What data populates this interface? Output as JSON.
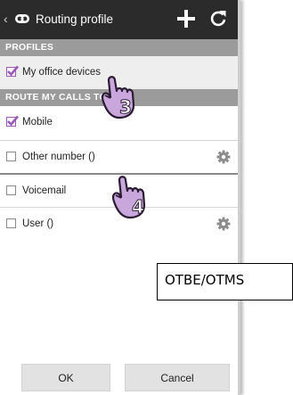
{
  "header": {
    "back_glyph": "‹",
    "title": "Routing profile",
    "icons": [
      "app-logo-icon",
      "plus-icon",
      "refresh-icon"
    ]
  },
  "profiles": {
    "section_label": "PROFILES",
    "items": [
      {
        "label": "My office devices",
        "checked": true
      }
    ]
  },
  "route": {
    "section_label": "ROUTE MY CALLS TO",
    "items": [
      {
        "label": "Mobile",
        "checked": true,
        "settings": false
      },
      {
        "label": "Other number ()",
        "checked": false,
        "settings": true
      },
      {
        "label": "Voicemail",
        "checked": false,
        "settings": false
      },
      {
        "label": "User ()",
        "checked": false,
        "settings": true
      }
    ]
  },
  "footer": {
    "ok_label": "OK",
    "cancel_label": "Cancel"
  },
  "annotations": {
    "step3": "3",
    "step4": "4",
    "callout_label": "OTBE/OTMS"
  },
  "colors": {
    "appbar": "#2b2b2b",
    "section": "#9b9b9b",
    "accent": "#9b59b6",
    "hand_fill": "#c9a7dc"
  }
}
